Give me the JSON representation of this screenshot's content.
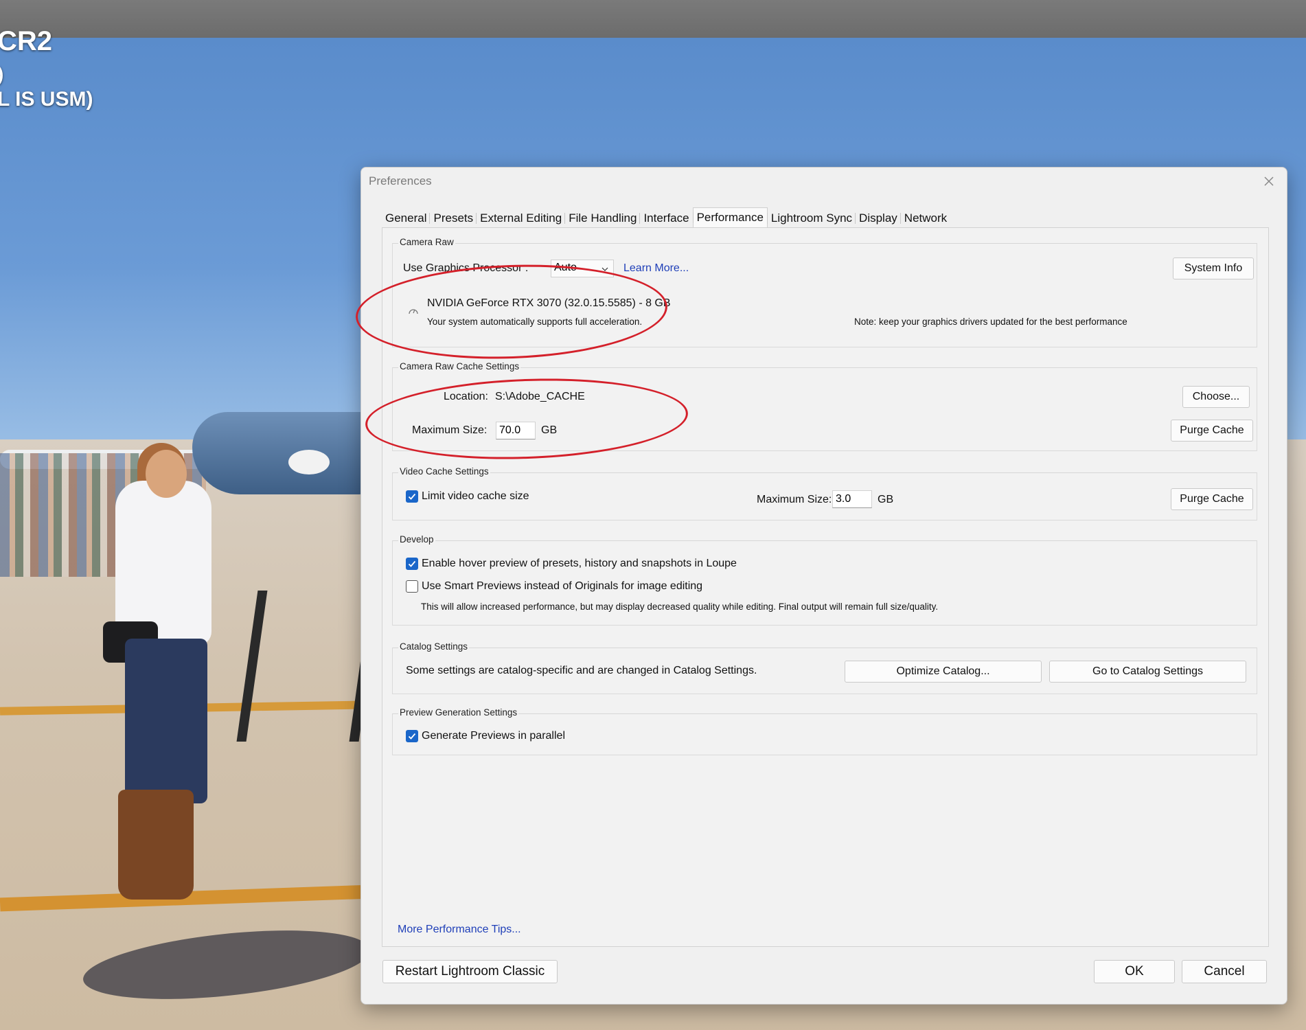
{
  "photo_overlay": {
    "line1": "CR2",
    "line2": ")",
    "line3": "L IS USM)"
  },
  "dialog": {
    "title": "Preferences",
    "tabs": [
      {
        "label": "General"
      },
      {
        "label": "Presets"
      },
      {
        "label": "External Editing"
      },
      {
        "label": "File Handling"
      },
      {
        "label": "Interface"
      },
      {
        "label": "Performance",
        "active": true
      },
      {
        "label": "Lightroom Sync"
      },
      {
        "label": "Display"
      },
      {
        "label": "Network"
      }
    ],
    "camera_raw": {
      "group_label": "Camera Raw",
      "gpu_label": "Use Graphics Processor :",
      "gpu_value": "Auto",
      "learn_more": "Learn More...",
      "system_info": "System Info",
      "gpu_name": "NVIDIA GeForce RTX 3070 (32.0.15.5585) - 8 GB",
      "gpu_status": "Your system automatically supports full acceleration.",
      "driver_note": "Note: keep your graphics drivers updated for the best performance"
    },
    "cache": {
      "group_label": "Camera Raw Cache Settings",
      "location_label": "Location:",
      "location_value": "S:\\Adobe_CACHE",
      "choose": "Choose...",
      "max_label": "Maximum Size:",
      "max_value": "70.0",
      "unit": "GB",
      "purge": "Purge Cache"
    },
    "video": {
      "group_label": "Video Cache Settings",
      "limit_label": "Limit video cache size",
      "limit_checked": true,
      "max_label": "Maximum Size:",
      "max_value": "3.0",
      "unit": "GB",
      "purge": "Purge Cache"
    },
    "develop": {
      "group_label": "Develop",
      "hover_label": "Enable hover preview of presets, history and snapshots in Loupe",
      "hover_checked": true,
      "smart_label": "Use Smart Previews instead of Originals for image editing",
      "smart_checked": false,
      "smart_note": "This will allow increased performance, but may display decreased quality while editing. Final output will remain full size/quality."
    },
    "catalog": {
      "group_label": "Catalog Settings",
      "text": "Some settings are catalog-specific and are changed in Catalog Settings.",
      "optimize": "Optimize Catalog...",
      "goto": "Go to Catalog Settings"
    },
    "preview": {
      "group_label": "Preview Generation Settings",
      "parallel_label": "Generate Previews in parallel",
      "parallel_checked": true
    },
    "more_tips": "More Performance Tips...",
    "restart": "Restart Lightroom Classic",
    "ok": "OK",
    "cancel": "Cancel"
  },
  "colors": {
    "checkbox_accent": "#1a66c9",
    "link": "#1f3fb8",
    "annotation_circle": "#d4202a"
  }
}
